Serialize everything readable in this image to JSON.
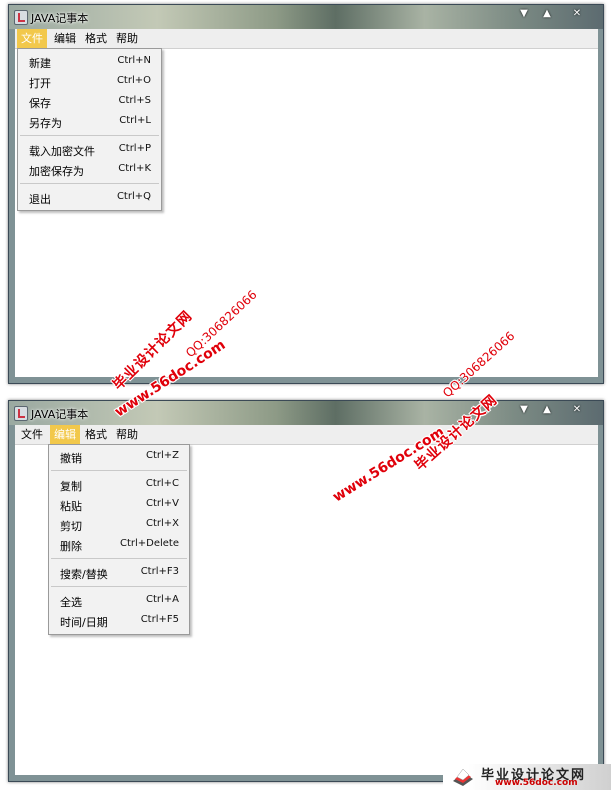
{
  "window1": {
    "title": "JAVA记事本",
    "controls": {
      "minimize": "▼",
      "maximize": "▲",
      "close": "✕"
    },
    "menubar": [
      "文件",
      "编辑",
      "格式",
      "帮助"
    ],
    "open_menu": "文件",
    "file_menu": [
      {
        "label": "新建",
        "shortcut": "Ctrl+N"
      },
      {
        "label": "打开",
        "shortcut": "Ctrl+O"
      },
      {
        "label": "保存",
        "shortcut": "Ctrl+S"
      },
      {
        "label": "另存为",
        "shortcut": "Ctrl+L"
      },
      {
        "label": "载入加密文件",
        "shortcut": "Ctrl+P"
      },
      {
        "label": "加密保存为",
        "shortcut": "Ctrl+K"
      },
      {
        "label": "退出",
        "shortcut": "Ctrl+Q"
      }
    ]
  },
  "window2": {
    "title": "JAVA记事本",
    "controls": {
      "minimize": "▼",
      "maximize": "▲",
      "close": "✕"
    },
    "menubar": [
      "文件",
      "编辑",
      "格式",
      "帮助"
    ],
    "open_menu": "编辑",
    "edit_menu": [
      {
        "label": "撤销",
        "shortcut": "Ctrl+Z"
      },
      {
        "label": "复制",
        "shortcut": "Ctrl+C"
      },
      {
        "label": "粘贴",
        "shortcut": "Ctrl+V"
      },
      {
        "label": "剪切",
        "shortcut": "Ctrl+X"
      },
      {
        "label": "删除",
        "shortcut": "Ctrl+Delete"
      },
      {
        "label": "搜索/替换",
        "shortcut": "Ctrl+F3"
      },
      {
        "label": "全选",
        "shortcut": "Ctrl+A"
      },
      {
        "label": "时间/日期",
        "shortcut": "Ctrl+F5"
      }
    ]
  },
  "watermark": {
    "site": "www.56doc.com",
    "name": "毕业设计论文网",
    "qq": "QQ:306826066"
  },
  "bottom_logo": {
    "name": "毕业设计论文网",
    "url": "www.56doc.com"
  },
  "colors": {
    "menu_highlight": "#f2c84b",
    "watermark_red": "#e0000a"
  }
}
